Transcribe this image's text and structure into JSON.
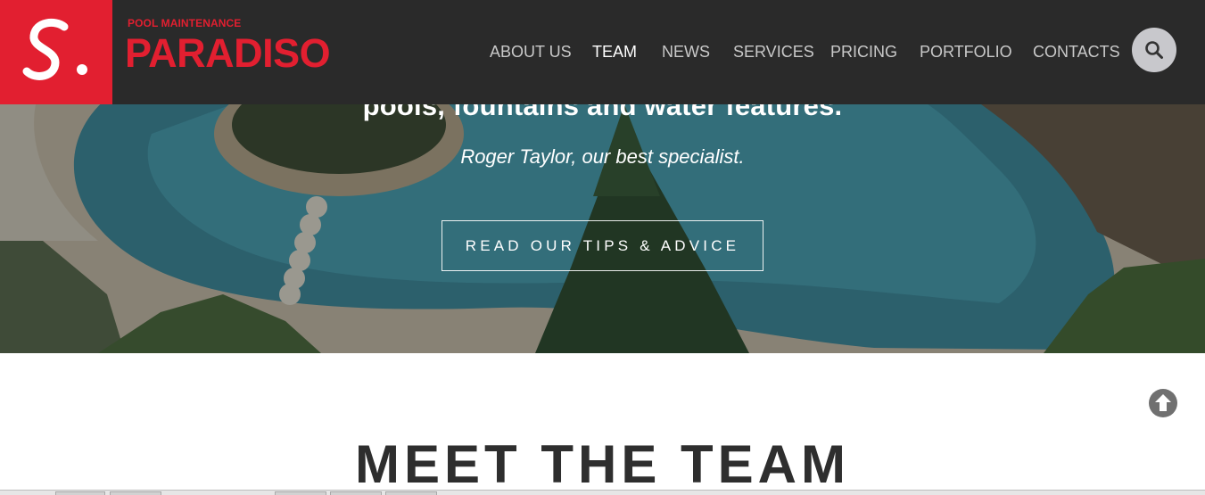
{
  "brand": {
    "kicker": "POOL MAINTENANCE",
    "name": "PARADISO",
    "mark": "S."
  },
  "nav": {
    "items": [
      {
        "label": "ABOUT US"
      },
      {
        "label": "TEAM"
      },
      {
        "label": "NEWS"
      },
      {
        "label": "SERVICES"
      },
      {
        "label": "PRICING"
      },
      {
        "label": "PORTFOLIO"
      },
      {
        "label": "CONTACTS"
      }
    ],
    "active": "TEAM",
    "search_icon": "search-icon"
  },
  "hero": {
    "quote": "pools, fountains and water features.",
    "author": "Roger Taylor, our best specialist.",
    "cta_label": "READ OUR TIPS & ADVICE"
  },
  "section": {
    "title": "MEET THE TEAM"
  },
  "icons": {
    "back_to_top": "arrow-up-circle-icon"
  },
  "colors": {
    "brand_red": "#e21f30",
    "header_bg": "#2a2a2a",
    "nav_text": "#c9c9c9",
    "nav_active": "#ffffff",
    "title_text": "#2e2e2e",
    "search_bg": "#c8c8cc"
  }
}
